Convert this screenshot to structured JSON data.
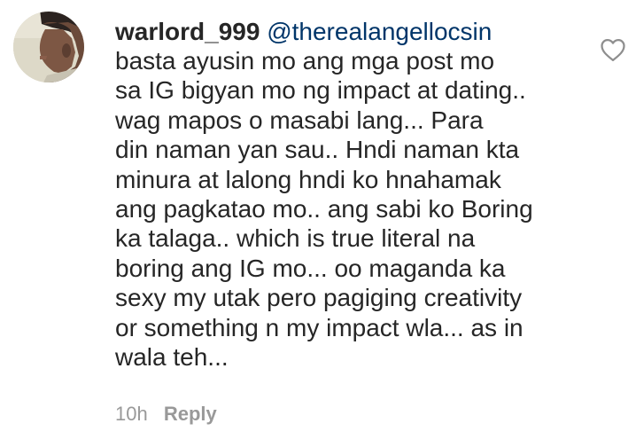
{
  "comment": {
    "username": "warlord_999",
    "mention": "@therealangellocsin",
    "lines": [
      "basta ayusin mo ang mga post mo",
      "sa IG bigyan mo ng impact at dating..",
      "wag mapos o masabi lang... Para",
      "din naman yan sau.. Hndi naman kta",
      "minura at lalong hndi ko hnahamak",
      "ang pagkatao mo.. ang sabi ko Boring",
      "ka talaga.. which is true literal na",
      "boring ang IG mo... oo maganda ka",
      "sexy my utak pero pagiging creativity",
      "or something n my impact wla... as in",
      "wala teh..."
    ],
    "time": "10h",
    "reply_label": "Reply"
  },
  "icons": {
    "like": "heart-outline-icon"
  },
  "colors": {
    "text": "#262626",
    "mention": "#003569",
    "meta": "#999999"
  }
}
